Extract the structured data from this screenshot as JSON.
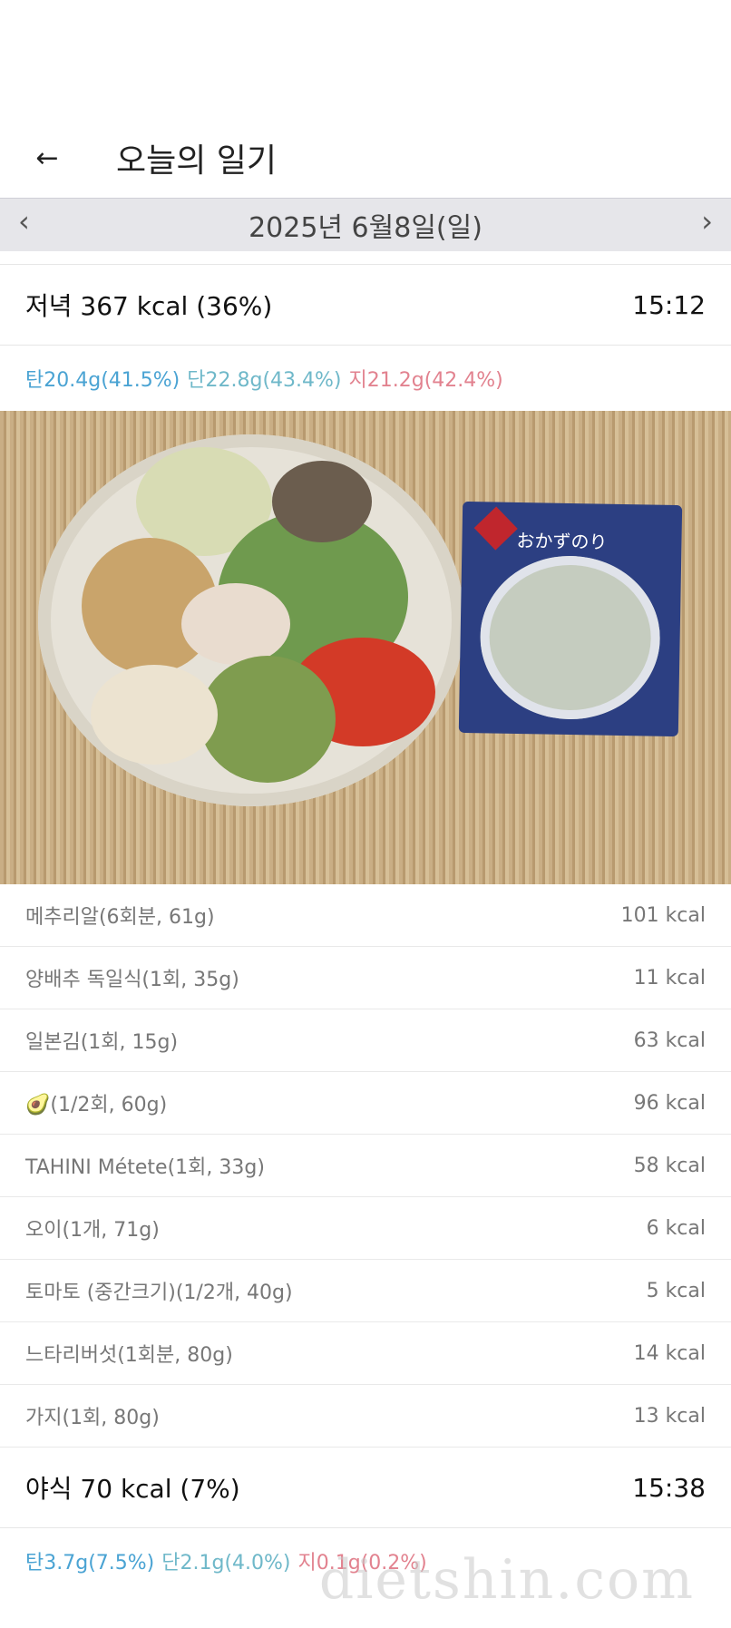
{
  "header": {
    "back_icon": "arrow-left-icon",
    "title": "오늘의 일기"
  },
  "date_bar": {
    "date": "2025년 6월8일(일)",
    "prev_icon": "chevron-left-icon",
    "next_icon": "chevron-right-icon"
  },
  "meals": [
    {
      "title": "저녁 367 kcal (36%)",
      "time": "15:12",
      "macros": {
        "carb": "탄20.4g(41.5%)",
        "protein": "단22.8g(43.4%)",
        "fat": "지21.2g(42.4%)"
      },
      "items": [
        {
          "name": "메추리알(6회분, 61g)",
          "kcal": "101 kcal"
        },
        {
          "name": "양배추 독일식(1회, 35g)",
          "kcal": "11 kcal"
        },
        {
          "name": "일본김(1회, 15g)",
          "kcal": "63 kcal"
        },
        {
          "name": "🥑(1/2회, 60g)",
          "kcal": "96 kcal"
        },
        {
          "name": "TAHINI Métete(1회, 33g)",
          "kcal": "58 kcal"
        },
        {
          "name": "오이(1개, 71g)",
          "kcal": "6 kcal"
        },
        {
          "name": "토마토 (중간크기)(1/2개, 40g)",
          "kcal": "5 kcal"
        },
        {
          "name": "느타리버섯(1회분, 80g)",
          "kcal": "14 kcal"
        },
        {
          "name": "가지(1회, 80g)",
          "kcal": "13 kcal"
        }
      ]
    },
    {
      "title": "야식 70 kcal (7%)",
      "time": "15:38",
      "macros": {
        "carb": "탄3.7g(7.5%)",
        "protein": "단2.1g(4.0%)",
        "fat": "지0.1g(0.2%)"
      }
    }
  ],
  "photo": {
    "package_text": "おかずのり"
  },
  "watermark": "dietshin.com",
  "colors": {
    "carb": "#4aa3d3",
    "protein": "#6fb8c9",
    "fat": "#e2828f",
    "date_bar_bg": "#e6e6ea"
  }
}
